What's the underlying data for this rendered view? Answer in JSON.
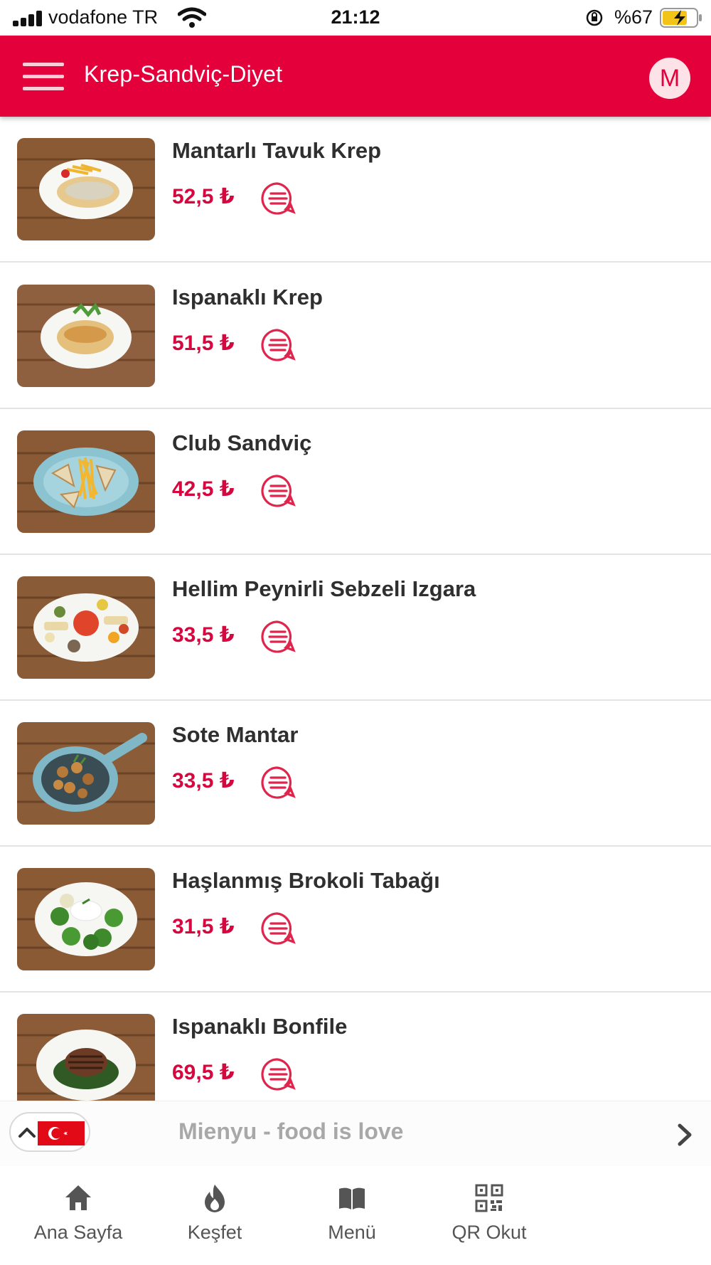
{
  "status_bar": {
    "carrier": "vodafone TR",
    "time": "21:12",
    "battery": "%67"
  },
  "header": {
    "title": "Krep-Sandviç-Diyet",
    "avatar_letter": "M",
    "accent_color": "#e4003b"
  },
  "items": [
    {
      "name": "Mantarlı Tavuk Krep",
      "price": "52,5 ₺",
      "photo_icon": "plate-crepe"
    },
    {
      "name": "Ispanaklı Krep",
      "price": "51,5 ₺",
      "photo_icon": "plate-crepe"
    },
    {
      "name": "Club Sandviç",
      "price": "42,5 ₺",
      "photo_icon": "plate-sandwich"
    },
    {
      "name": "Hellim Peynirli Sebzeli Izgara",
      "price": "33,5 ₺",
      "photo_icon": "plate-grill"
    },
    {
      "name": "Sote Mantar",
      "price": "33,5 ₺",
      "photo_icon": "pan-mushroom"
    },
    {
      "name": "Haşlanmış Brokoli Tabağı",
      "price": "31,5 ₺",
      "photo_icon": "plate-broccoli"
    },
    {
      "name": "Ispanaklı Bonfile",
      "price": "69,5 ₺",
      "photo_icon": "plate-steak"
    }
  ],
  "footer": {
    "brand": "Mienyu - food is love",
    "language_flag": "turkey-flag-icon"
  },
  "nav": [
    {
      "label": "Ana Sayfa",
      "icon": "home-icon"
    },
    {
      "label": "Keşfet",
      "icon": "flame-icon"
    },
    {
      "label": "Menü",
      "icon": "book-icon"
    },
    {
      "label": "QR Okut",
      "icon": "qr-code-icon"
    }
  ]
}
